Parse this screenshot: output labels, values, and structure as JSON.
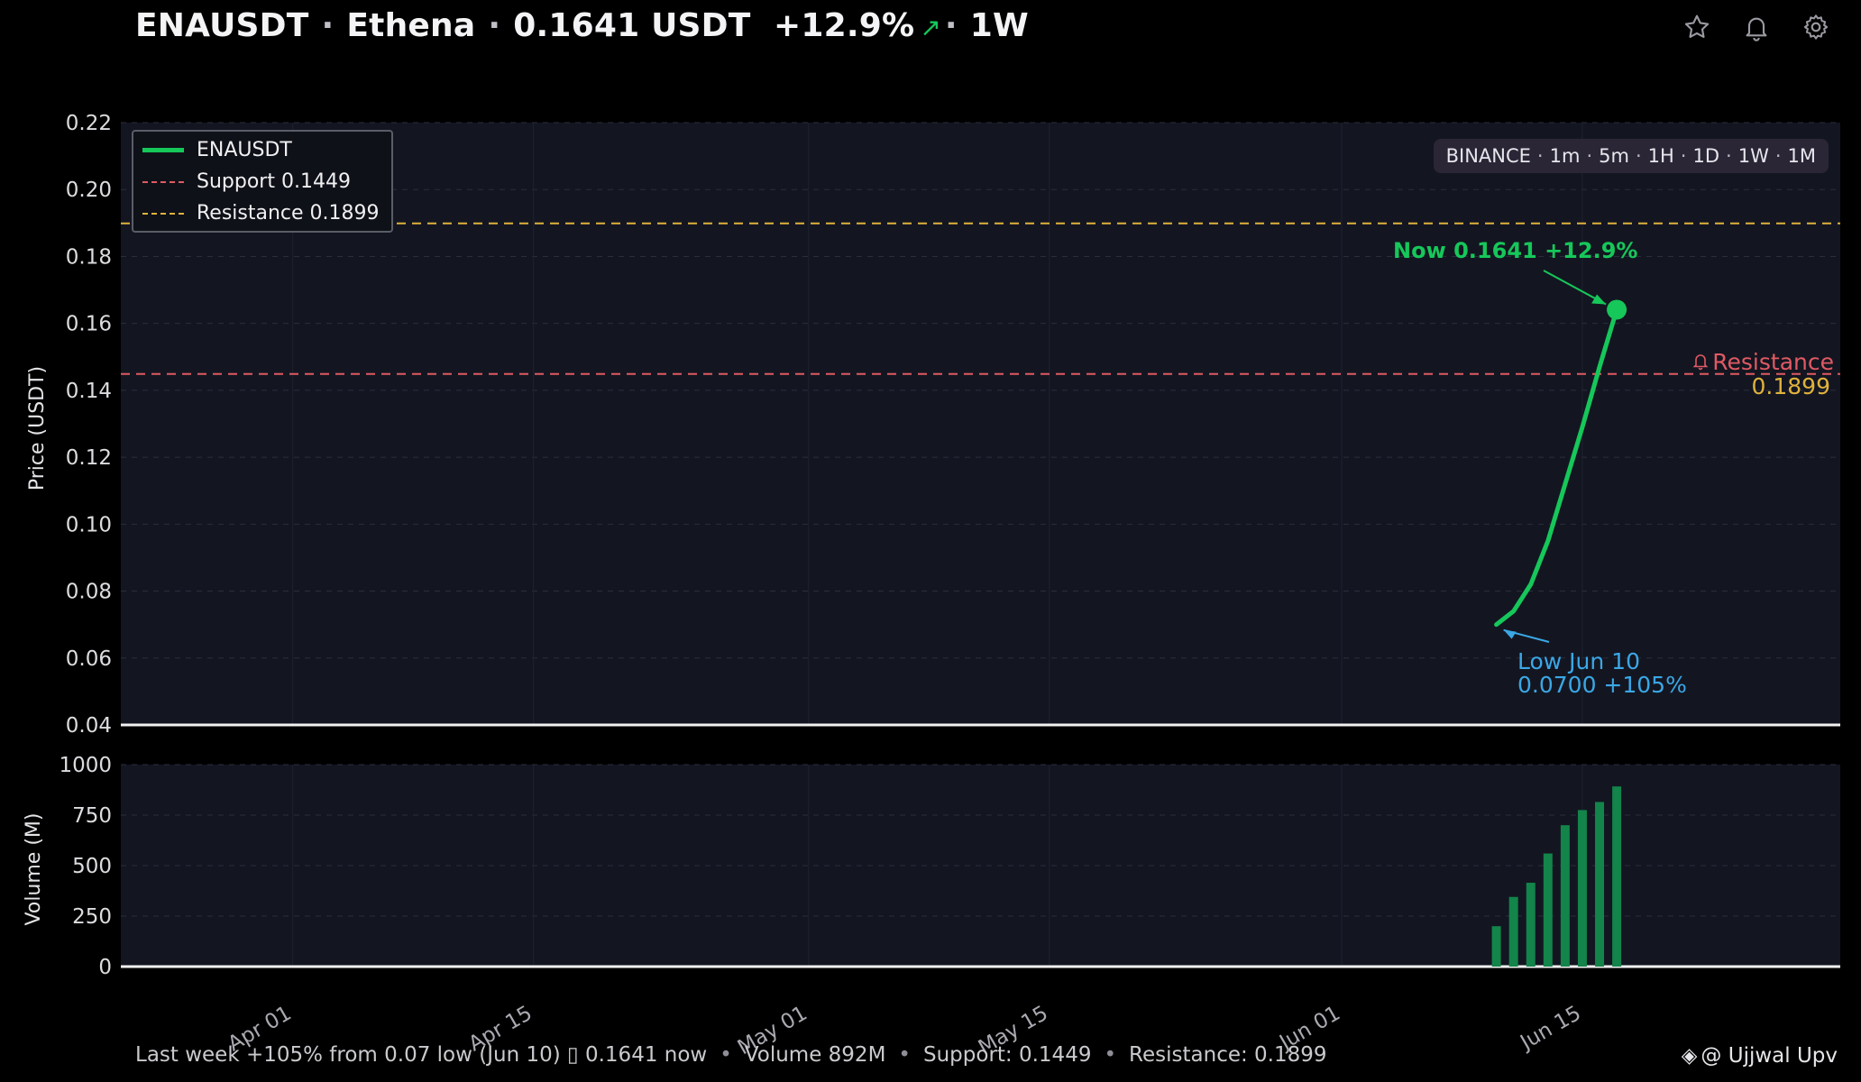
{
  "header": {
    "symbol": "ENAUSDT",
    "name": "Ethena",
    "price": "0.1641 USDT",
    "change": "+12.9%",
    "interval": "1W",
    "icons": [
      "star-icon",
      "bell-icon",
      "gear-icon"
    ]
  },
  "legend": {
    "series": "ENAUSDT",
    "support": "Support 0.1449",
    "resistance": "Resistance 0.1899"
  },
  "exchange_bar": {
    "exchange": "BINANCE",
    "intervals": [
      "1m",
      "5m",
      "1H",
      "1D",
      "1W",
      "1M"
    ]
  },
  "annotations": {
    "now": "Now 0.1641  +12.9%",
    "low_line1": "Low  Jun 10",
    "low_line2": "0.0700  +105%",
    "right_label": "Resistance",
    "right_value": "0.1899"
  },
  "footer": {
    "parts": [
      "Last week +105% from 0.07 low (Jun 10) ▯ 0.1641 now",
      "Volume 892M",
      "Support: 0.1449",
      "Resistance: 0.1899"
    ]
  },
  "watermark": "@ Ujjwal Upv",
  "colors": {
    "price_line": "#16c75a",
    "support": "#e05a63",
    "resistance": "#e0b23c",
    "low_annotation": "#3ba7e6",
    "volume_bar": "#13844a"
  },
  "chart_data": {
    "type": "line",
    "price_axis": {
      "ylabel": "Price (USDT)",
      "ylim": [
        0.04,
        0.22
      ],
      "yticks": [
        "0.04",
        "0.06",
        "0.08",
        "0.10",
        "0.12",
        "0.14",
        "0.16",
        "0.18",
        "0.20",
        "0.22"
      ]
    },
    "volume_axis": {
      "ylabel": "Volume (M)",
      "ylim": [
        0,
        1000
      ],
      "yticks": [
        "0",
        "250",
        "500",
        "750",
        "1000"
      ]
    },
    "xlim": [
      "2024-03-22",
      "2024-06-30"
    ],
    "xticks": [
      {
        "date": "2024-04-01",
        "label": "Apr 01"
      },
      {
        "date": "2024-04-15",
        "label": "Apr 15"
      },
      {
        "date": "2024-05-01",
        "label": "May 01"
      },
      {
        "date": "2024-05-15",
        "label": "May 15"
      },
      {
        "date": "2024-06-01",
        "label": "Jun 01"
      },
      {
        "date": "2024-06-15",
        "label": "Jun 15"
      }
    ],
    "series": [
      {
        "name": "ENAUSDT",
        "points": [
          {
            "x": "2024-06-10",
            "y": 0.07
          },
          {
            "x": "2024-06-11",
            "y": 0.074
          },
          {
            "x": "2024-06-12",
            "y": 0.082
          },
          {
            "x": "2024-06-13",
            "y": 0.095
          },
          {
            "x": "2024-06-14",
            "y": 0.112
          },
          {
            "x": "2024-06-15",
            "y": 0.129
          },
          {
            "x": "2024-06-16",
            "y": 0.147
          },
          {
            "x": "2024-06-17",
            "y": 0.1641
          }
        ]
      }
    ],
    "volume": [
      {
        "x": "2024-06-10",
        "y": 200
      },
      {
        "x": "2024-06-11",
        "y": 345
      },
      {
        "x": "2024-06-12",
        "y": 415
      },
      {
        "x": "2024-06-13",
        "y": 560
      },
      {
        "x": "2024-06-14",
        "y": 700
      },
      {
        "x": "2024-06-15",
        "y": 775
      },
      {
        "x": "2024-06-16",
        "y": 815
      },
      {
        "x": "2024-06-17",
        "y": 892
      }
    ],
    "support": 0.1449,
    "resistance": 0.1899,
    "grid": true,
    "legend_position": "top-left"
  }
}
